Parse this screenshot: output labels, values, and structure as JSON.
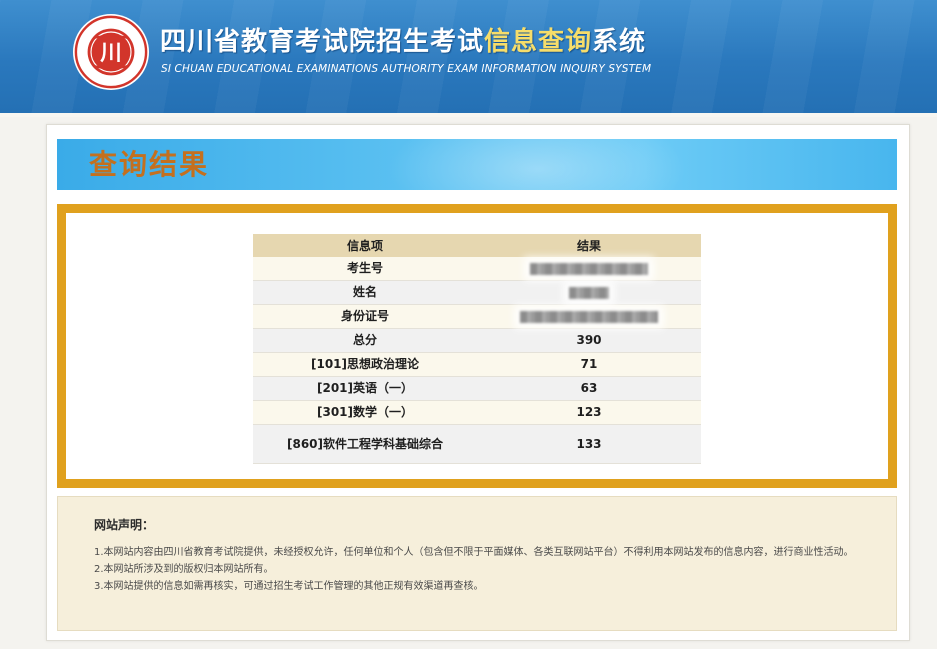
{
  "header": {
    "title_main": "四川省教育考试院招生考试",
    "title_accent": "信息查询",
    "title_tail": "系统",
    "subtitle": "SI CHUAN EDUCATIONAL EXAMINATIONS AUTHORITY EXAM INFORMATION INQUIRY SYSTEM",
    "logo_icon": "sichuan-exam-authority-seal",
    "logo_glyph": "川"
  },
  "result": {
    "title": "查询结果",
    "columns": [
      "信息项",
      "结果"
    ],
    "rows": [
      {
        "label": "考生号",
        "value": null,
        "redacted": true
      },
      {
        "label": "姓名",
        "value": null,
        "redacted": true
      },
      {
        "label": "身份证号",
        "value": null,
        "redacted": true
      },
      {
        "label": "总分",
        "value": "390"
      },
      {
        "label": "[101]思想政治理论",
        "value": "71"
      },
      {
        "label": "[201]英语（一）",
        "value": "63"
      },
      {
        "label": "[301]数学（一）",
        "value": "123"
      },
      {
        "label": "[860]软件工程学科基础综合",
        "value": "133"
      }
    ]
  },
  "notice": {
    "title": "网站声明：",
    "items": [
      "1.本网站内容由四川省教育考试院提供，未经授权允许，任何单位和个人（包含但不限于平面媒体、各类互联网站平台）不得利用本网站发布的信息内容，进行商业性活动。",
      "2.本网站所涉及到的版权归本网站所有。",
      "3.本网站提供的信息如需再核实，可通过招生考试工作管理的其他正规有效渠道再查核。"
    ]
  },
  "colors": {
    "header_blue": "#2a78bd",
    "title_accent": "#f6dd6a",
    "result_title": "#c4701f",
    "frame_gold": "#e0a11e",
    "banner_blue": "#5dc2f2",
    "logo_red": "#d2352b"
  }
}
